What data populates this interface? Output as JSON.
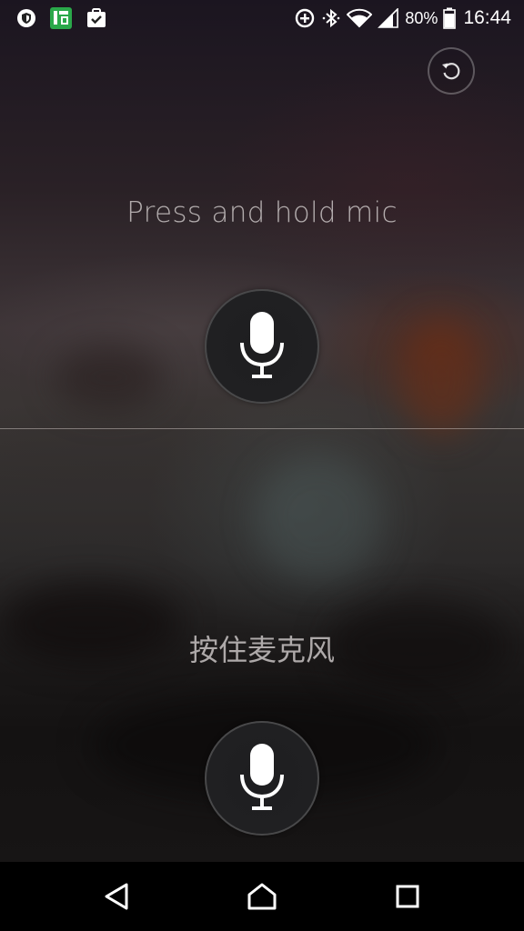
{
  "status_bar": {
    "battery_percent": "80%",
    "time": "16:44",
    "left_icons": [
      "shield-icon",
      "app-notification-icon",
      "clipboard-check-icon"
    ],
    "right_icons": [
      "data-saver-icon",
      "bluetooth-icon",
      "wifi-icon",
      "signal-icon",
      "battery-icon"
    ]
  },
  "toolbar": {
    "reset_icon": "rotate-ccw-icon"
  },
  "top_panel": {
    "prompt": "Press and hold mic",
    "mic_icon": "microphone-icon"
  },
  "bottom_panel": {
    "prompt": "按住麦克风",
    "mic_icon": "microphone-icon"
  },
  "nav_bar": {
    "buttons": [
      "back-icon",
      "home-icon",
      "recents-icon"
    ]
  },
  "colors": {
    "status_text": "#ffffff",
    "prompt_text": "#d7d2d2",
    "mic_button_bg": "#1e1e20",
    "divider": "#e1d7d2",
    "nav_bar_bg": "#000000",
    "app_icon_green": "#2aa84a"
  }
}
